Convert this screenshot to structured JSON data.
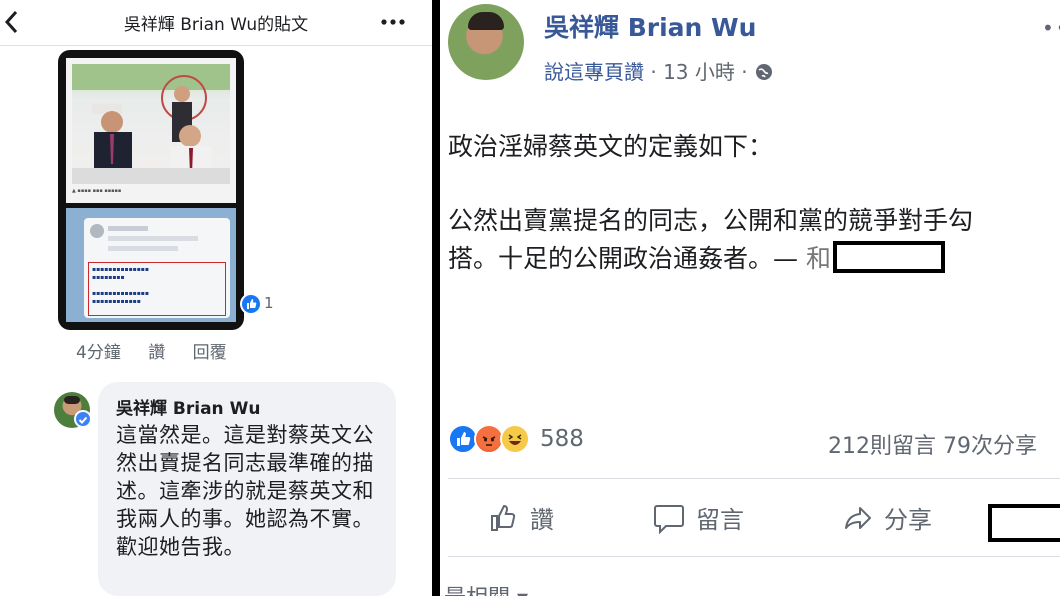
{
  "left_panel": {
    "header": {
      "title": "吳祥輝 Brian Wu的貼文",
      "back_icon": "chevron-left-icon",
      "more_icon": "more-icon"
    },
    "image_like_count": "1",
    "comment_meta": {
      "time": "4分鐘",
      "like": "讚",
      "reply": "回覆"
    },
    "reply": {
      "author": "吳祥輝 Brian Wu",
      "text": "這當然是。這是對蔡英文公然出賣提名同志最準確的描述。這牽涉的就是蔡英文和我兩人的事。她認為不實。歡迎她告我。"
    }
  },
  "right_panel": {
    "poster_name": "吳祥輝 Brian Wu",
    "liked_page": "說這專頁讚",
    "time": " · 13 小時 · ",
    "post_line1": "政治淫婦蔡英文的定義如下：",
    "post_line2": "公然出賣黨提名的同志，公開和黨的競爭對手勾",
    "post_line3": "搭。十足的公開政治通姦者。— ",
    "post_line3_faded": "和",
    "reaction_count": "588",
    "counts": "212則留言  79次分享",
    "actions": {
      "like": "讚",
      "comment": "留言",
      "share": "分享"
    },
    "related": "最相關 ▾"
  },
  "colors": {
    "facebook_blue": "#385898",
    "like_blue": "#1877f2",
    "gray_text": "#606770",
    "bubble_bg": "#f0f2f5"
  }
}
